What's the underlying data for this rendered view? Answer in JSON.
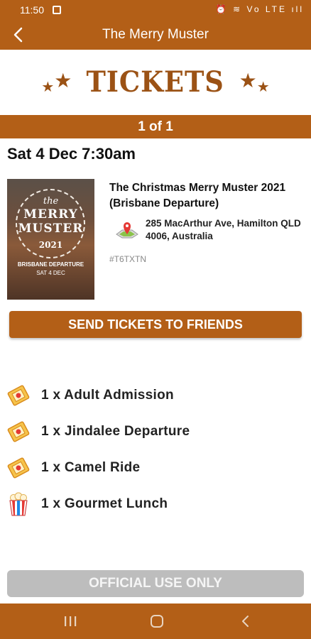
{
  "status_bar": {
    "time": "11:50",
    "icons": "⏰ ≋ Vo LTE ıll"
  },
  "app_bar": {
    "title": "The Merry Muster"
  },
  "header": {
    "title": "TICKETS"
  },
  "pager": {
    "text": "1 of 1"
  },
  "event": {
    "date": "Sat 4 Dec 7:30am",
    "name": "The Christmas Merry Muster 2021 (Brisbane Departure)",
    "address": "285 MacArthur Ave, Hamilton QLD 4006, Australia",
    "order_code": "#T6TXTN",
    "image": {
      "the": "the",
      "merry": "MERRY",
      "muster": "MUSTER",
      "year": "2021",
      "departure": "BRISBANE DEPARTURE",
      "date": "SAT 4 DEC"
    }
  },
  "actions": {
    "send_tickets": "SEND TICKETS TO FRIENDS"
  },
  "items": [
    {
      "label": "1 x Adult Admission",
      "icon": "ticket-icon"
    },
    {
      "label": "1 x Jindalee Departure",
      "icon": "ticket-icon"
    },
    {
      "label": "1 x Camel Ride",
      "icon": "ticket-icon"
    },
    {
      "label": "1 x Gourmet Lunch",
      "icon": "popcorn-icon"
    }
  ],
  "footer": {
    "official": "OFFICIAL USE ONLY"
  },
  "colors": {
    "brand": "#b35f17",
    "accent_dark": "#9b5215",
    "disabled": "#bdbdbd"
  }
}
